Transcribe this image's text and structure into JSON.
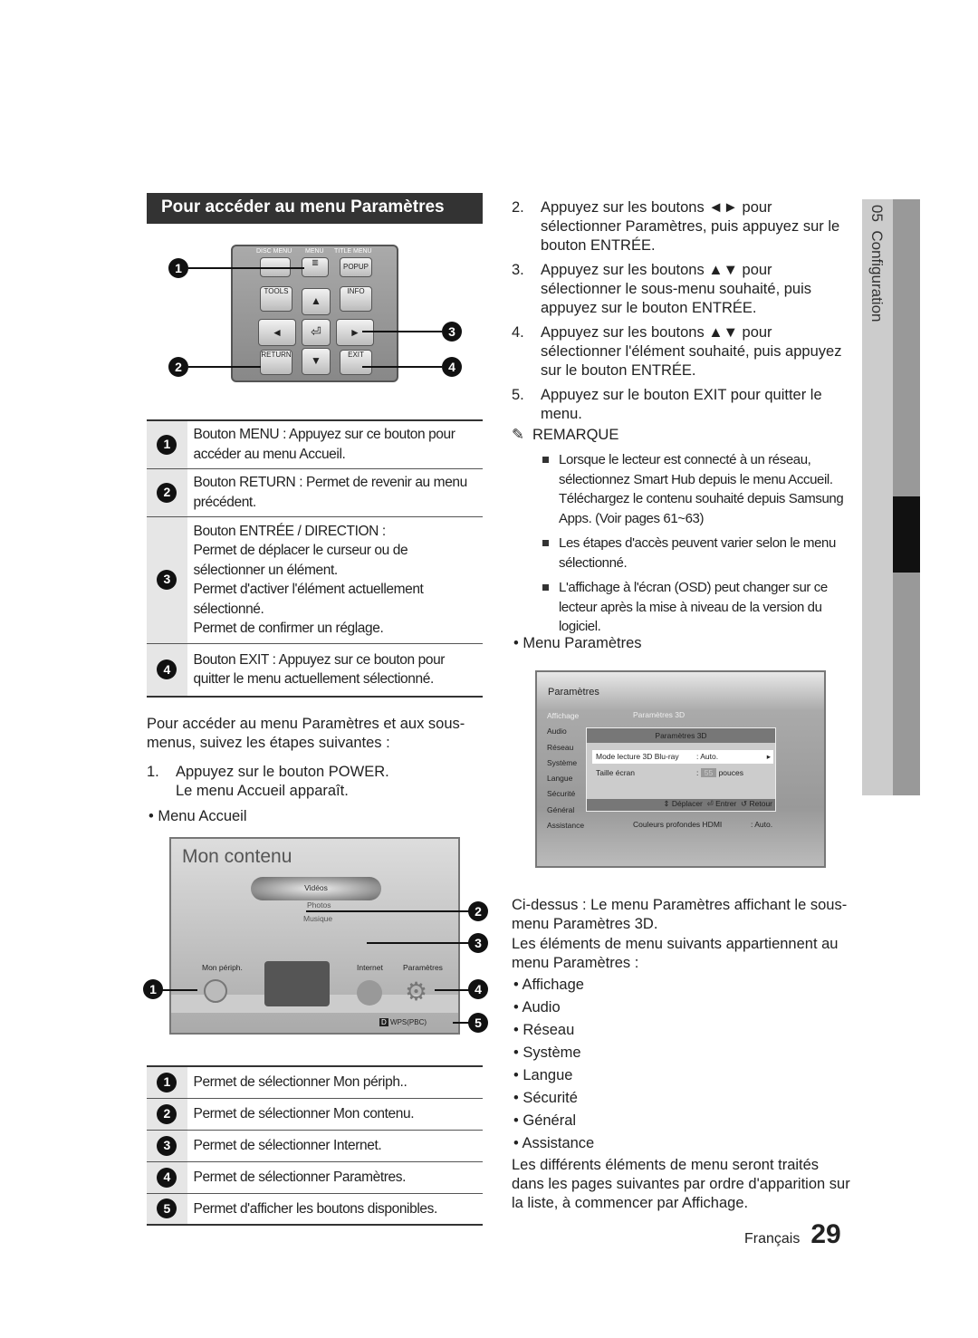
{
  "section_title": "Pour accéder au menu Paramètres",
  "remote": {
    "labels": [
      "DISC MENU",
      "MENU",
      "TITLE MENU",
      "POPUP",
      "TOOLS",
      "INFO",
      "RETURN",
      "EXIT"
    ],
    "callouts": [
      "1",
      "2",
      "3",
      "4"
    ]
  },
  "table1": [
    {
      "n": "1",
      "lines": [
        "Bouton MENU : Appuyez sur ce bouton pour accéder au menu Accueil."
      ]
    },
    {
      "n": "2",
      "lines": [
        "Bouton RETURN : Permet de revenir au menu précédent."
      ]
    },
    {
      "n": "3",
      "lines": [
        "Bouton ENTRÉE / DIRECTION :",
        "Permet de déplacer le curseur ou de sélectionner un élément.",
        "Permet d'activer l'élément actuellement sélectionné.",
        "Permet de confirmer un réglage."
      ]
    },
    {
      "n": "4",
      "lines": [
        "Bouton EXIT : Appuyez sur ce bouton pour quitter le menu actuellement sélectionné."
      ]
    }
  ],
  "intro": "Pour accéder au menu Paramètres et aux sous-menus, suivez les étapes suivantes :",
  "step1": {
    "n": "1.",
    "text": "Appuyez sur le bouton POWER.",
    "sub": "Le menu Accueil apparaît."
  },
  "menu_accueil": "Menu Accueil",
  "home_screen": {
    "title": "Mon contenu",
    "items": [
      "Vidéos",
      "Photos",
      "Musique"
    ],
    "icons": [
      "Mon périph.",
      "Internet",
      "Paramètres"
    ],
    "footer_key": "D",
    "footer": "WPS(PBC)",
    "callouts": [
      "1",
      "2",
      "3",
      "4",
      "5"
    ]
  },
  "table2": [
    {
      "n": "1",
      "text": "Permet de sélectionner Mon périph.."
    },
    {
      "n": "2",
      "text": "Permet de sélectionner Mon contenu."
    },
    {
      "n": "3",
      "text": "Permet de sélectionner Internet."
    },
    {
      "n": "4",
      "text": "Permet de sélectionner Paramètres."
    },
    {
      "n": "5",
      "text": "Permet d'afficher les boutons disponibles."
    }
  ],
  "steps": [
    {
      "n": "2.",
      "text": "Appuyez sur les boutons ◄► pour sélectionner Paramètres, puis appuyez sur le bouton ENTRÉE."
    },
    {
      "n": "3.",
      "text": "Appuyez sur les boutons ▲▼ pour sélectionner le sous-menu souhaité, puis appuyez sur le bouton ENTRÉE."
    },
    {
      "n": "4.",
      "text": "Appuyez sur les boutons ▲▼ pour sélectionner l'élément souhaité, puis appuyez sur le bouton ENTRÉE."
    },
    {
      "n": "5.",
      "text": "Appuyez sur le bouton EXIT pour quitter le menu."
    }
  ],
  "remarque": {
    "title": "REMARQUE",
    "items": [
      "Lorsque le lecteur est connecté à un réseau, sélectionnez Smart Hub depuis le menu Accueil. Téléchargez le contenu souhaité depuis Samsung Apps. (Voir pages 61~63)",
      "Les étapes d'accès peuvent varier selon le menu sélectionné.",
      "L'affichage à l'écran (OSD) peut changer sur ce lecteur après la mise à niveau de la version du logiciel."
    ]
  },
  "menu_parametres": "Menu Paramètres",
  "settings_screen": {
    "title": "Paramètres",
    "menu": [
      "Affichage",
      "Audio",
      "Réseau",
      "Système",
      "Langue",
      "Sécurité",
      "Général",
      "Assistance"
    ],
    "top_item": "Paramètres 3D",
    "popup_title": "Paramètres 3D",
    "rows": [
      {
        "label": "Mode lecture 3D Blu-ray",
        "value": ": Auto."
      },
      {
        "label": "Taille écran",
        "value": "55",
        "unit": "pouces"
      }
    ],
    "footer": [
      "Déplacer",
      "Entrer",
      "Retour"
    ],
    "bottom_label": "Couleurs profondes HDMI",
    "bottom_value": ": Auto."
  },
  "caption": "Ci-dessus : Le menu Paramètres affichant le sous-menu Paramètres 3D.",
  "list_intro": "Les éléments de menu suivants appartiennent au menu Paramètres :",
  "list": [
    "Affichage",
    "Audio",
    "Réseau",
    "Système",
    "Langue",
    "Sécurité",
    "Général",
    "Assistance"
  ],
  "outro": "Les différents éléments de menu seront traités dans les pages suivantes par ordre d'apparition sur la liste, à commencer par Affichage.",
  "footer": {
    "lang": "Français",
    "page": "29"
  },
  "side_tab": {
    "chapter": "05",
    "title": "Configuration"
  }
}
